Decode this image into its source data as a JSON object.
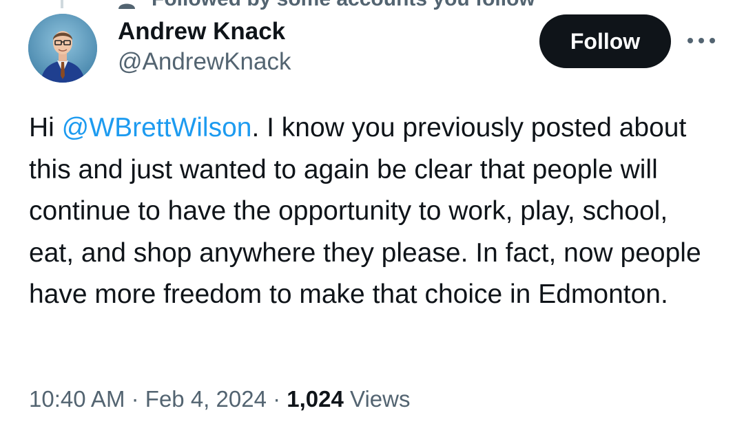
{
  "social_context": {
    "text": "Followed by some accounts you follow"
  },
  "author": {
    "display_name": "Andrew Knack",
    "handle": "@AndrewKnack",
    "avatar_icon": "profile-photo"
  },
  "actions": {
    "follow_label": "Follow",
    "more_icon": "more-horizontal-icon"
  },
  "tweet": {
    "segments": [
      {
        "type": "text",
        "value": "Hi "
      },
      {
        "type": "mention",
        "value": "@WBrettWilson"
      },
      {
        "type": "text",
        "value": ". I know you previously posted about this and just wanted to again be clear that people will continue to have the opportunity to work, play, school, eat, and shop anywhere they please. In fact, now people have more freedom to make that choice in Edmonton."
      }
    ]
  },
  "meta": {
    "time": "10:40 AM",
    "separator": "·",
    "date": "Feb 4, 2024",
    "views_count": "1,024",
    "views_label": "Views"
  },
  "colors": {
    "text_primary": "#0f1419",
    "text_secondary": "#536471",
    "link": "#1d9bf0",
    "button_bg": "#0f1419",
    "button_text": "#ffffff"
  }
}
